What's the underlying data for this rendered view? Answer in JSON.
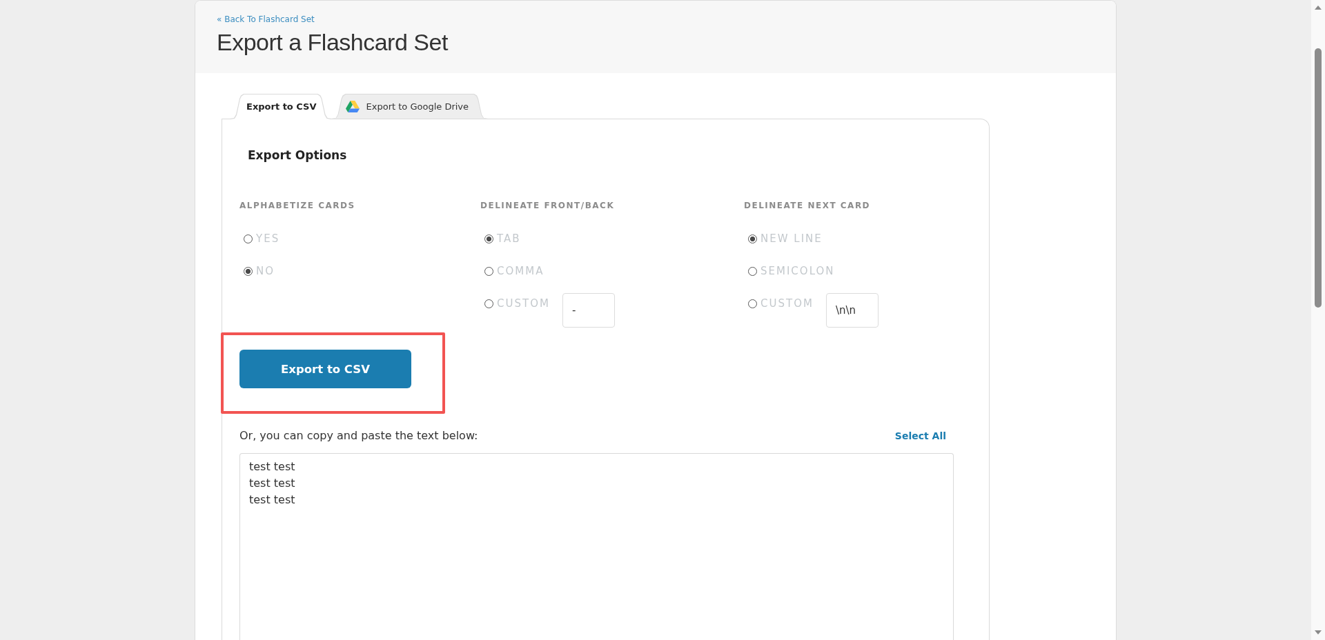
{
  "back_link": "« Back To Flashcard Set",
  "title": "Export a Flashcard Set",
  "tabs": [
    {
      "label": "Export to CSV",
      "selected": true,
      "has_icon": false
    },
    {
      "label": "Export to Google Drive",
      "selected": false,
      "has_icon": true
    }
  ],
  "export_options": {
    "title": "Export Options",
    "groups": [
      {
        "heading": "ALPHABETIZE CARDS",
        "options": [
          {
            "label": "YES",
            "selected": false,
            "kind": "plain"
          },
          {
            "label": "NO",
            "selected": true,
            "kind": "plain"
          }
        ]
      },
      {
        "heading": "DELINEATE FRONT/BACK",
        "options": [
          {
            "label": "TAB",
            "selected": true,
            "kind": "plain"
          },
          {
            "label": "COMMA",
            "selected": false,
            "kind": "plain"
          },
          {
            "label": "CUSTOM",
            "selected": false,
            "kind": "custom",
            "value": "-"
          }
        ]
      },
      {
        "heading": "DELINEATE NEXT CARD",
        "options": [
          {
            "label": "NEW LINE",
            "selected": true,
            "kind": "plain"
          },
          {
            "label": "SEMICOLON",
            "selected": false,
            "kind": "plain"
          },
          {
            "label": "CUSTOM",
            "selected": false,
            "kind": "custom",
            "value": "\\n\\n"
          }
        ]
      }
    ]
  },
  "export_button": {
    "label": "Export to CSV",
    "highlighted": true
  },
  "copy_prompt": "Or, you can copy and paste the text below:",
  "select_all": "Select All",
  "export_text": "test test\ntest test\ntest test"
}
